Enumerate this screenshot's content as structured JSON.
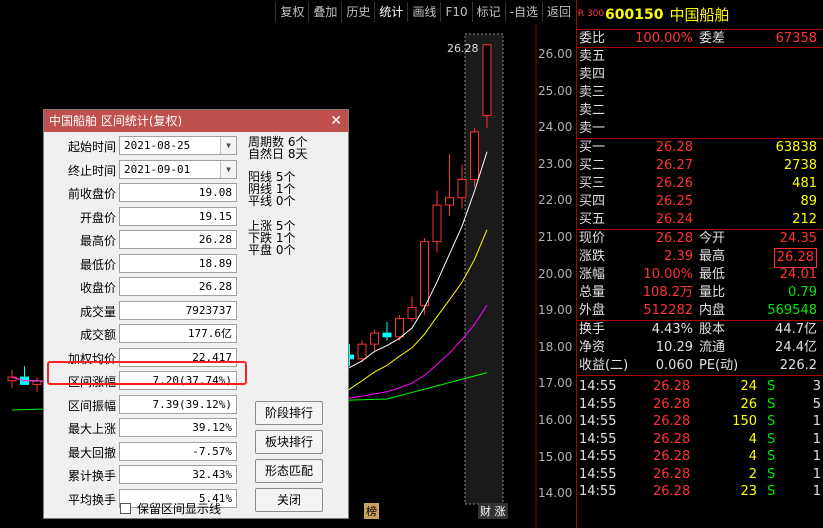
{
  "toolbar": [
    "复权",
    "叠加",
    "历史",
    "统计",
    "画线",
    "F10",
    "标记",
    "-自选",
    "返回"
  ],
  "chart": {
    "price_ticks": [
      "26.00",
      "25.00",
      "24.00",
      "23.00",
      "22.00",
      "21.00",
      "20.00",
      "19.00",
      "18.00",
      "17.00",
      "16.00",
      "15.00",
      "14.00"
    ],
    "high_marker": "26.28",
    "bottom_labels": [
      "榜",
      "财 涨"
    ],
    "colors": {
      "up": "#ff3232",
      "down": "#00ffff",
      "ma5": "#ffffff",
      "ma10": "#ffff00",
      "ma20": "#ff00ff",
      "ma60": "#00ff00"
    }
  },
  "quote": {
    "market_mark": "R 300",
    "code": "600150",
    "name": "中国船舶",
    "weibi": {
      "label": "委比",
      "value": "100.00%",
      "label2": "委差",
      "value2": "67358"
    },
    "asks": [
      {
        "label": "卖五",
        "price": "",
        "vol": ""
      },
      {
        "label": "卖四",
        "price": "",
        "vol": ""
      },
      {
        "label": "卖三",
        "price": "",
        "vol": ""
      },
      {
        "label": "卖二",
        "price": "",
        "vol": ""
      },
      {
        "label": "卖一",
        "price": "",
        "vol": ""
      }
    ],
    "bids": [
      {
        "label": "买一",
        "price": "26.28",
        "vol": "63838"
      },
      {
        "label": "买二",
        "price": "26.27",
        "vol": "2738"
      },
      {
        "label": "买三",
        "price": "26.26",
        "vol": "481"
      },
      {
        "label": "买四",
        "price": "26.25",
        "vol": "89"
      },
      {
        "label": "买五",
        "price": "26.24",
        "vol": "212"
      }
    ],
    "stats": [
      {
        "l1": "现价",
        "v1": "26.28",
        "l2": "今开",
        "v2": "24.35"
      },
      {
        "l1": "涨跌",
        "v1": "2.39",
        "l2": "最高",
        "v2": "26.28"
      },
      {
        "l1": "涨幅",
        "v1": "10.00%",
        "l2": "最低",
        "v2": "24.01"
      },
      {
        "l1": "总量",
        "v1": "108.2万",
        "l2": "量比",
        "v2": "0.79"
      },
      {
        "l1": "外盘",
        "v1": "512282",
        "l2": "内盘",
        "v2": "569548"
      }
    ],
    "stats2": [
      {
        "l1": "换手",
        "v1": "4.43%",
        "l2": "股本",
        "v2": "44.7亿"
      },
      {
        "l1": "净资",
        "v1": "10.29",
        "l2": "流通",
        "v2": "24.4亿"
      },
      {
        "l1": "收益(二)",
        "v1": "0.060",
        "l2": "PE(动)",
        "v2": "226.2"
      }
    ],
    "ticks": [
      {
        "time": "14:55",
        "price": "26.28",
        "vol": "24",
        "bs": "S",
        "n": "3"
      },
      {
        "time": "14:55",
        "price": "26.28",
        "vol": "26",
        "bs": "S",
        "n": "5"
      },
      {
        "time": "14:55",
        "price": "26.28",
        "vol": "150",
        "bs": "S",
        "n": "1"
      },
      {
        "time": "14:55",
        "price": "26.28",
        "vol": "4",
        "bs": "S",
        "n": "1"
      },
      {
        "time": "14:55",
        "price": "26.28",
        "vol": "4",
        "bs": "S",
        "n": "1"
      },
      {
        "time": "14:55",
        "price": "26.28",
        "vol": "2",
        "bs": "S",
        "n": "1"
      },
      {
        "time": "14:55",
        "price": "26.28",
        "vol": "23",
        "bs": "S",
        "n": "1"
      }
    ]
  },
  "dialog": {
    "title": "中国船舶 区间统计(复权)",
    "close": "✕",
    "fields": [
      {
        "label": "起始时间",
        "value": "2021-08-25",
        "combo": true
      },
      {
        "label": "终止时间",
        "value": "2021-09-01",
        "combo": true
      },
      {
        "label": "前收盘价",
        "value": "19.08"
      },
      {
        "label": "开盘价",
        "value": "19.15"
      },
      {
        "label": "最高价",
        "value": "26.28"
      },
      {
        "label": "最低价",
        "value": "18.89"
      },
      {
        "label": "收盘价",
        "value": "26.28"
      },
      {
        "label": "成交量",
        "value": "7923737"
      },
      {
        "label": "成交额",
        "value": "177.6亿"
      },
      {
        "label": "加权均价",
        "value": "22.417"
      },
      {
        "label": "区间涨幅",
        "value": "7.20(37.74%)"
      },
      {
        "label": "区间振幅",
        "value": "7.39(39.12%)"
      },
      {
        "label": "最大上涨",
        "value": "39.12%"
      },
      {
        "label": "最大回撤",
        "value": "-7.57%"
      },
      {
        "label": "累计换手",
        "value": "32.43%"
      },
      {
        "label": "平均换手",
        "value": "5.41%"
      }
    ],
    "stats": [
      "周期数 6个",
      "自然日 8天",
      "阳线 5个",
      "阴线 1个",
      "平线 0个",
      "上涨 5个",
      "下跌 1个",
      "平盘 0个"
    ],
    "buttons": [
      "阶段排行",
      "板块排行",
      "形态匹配",
      "关闭"
    ],
    "checkbox_label": "保留区间显示线"
  }
}
